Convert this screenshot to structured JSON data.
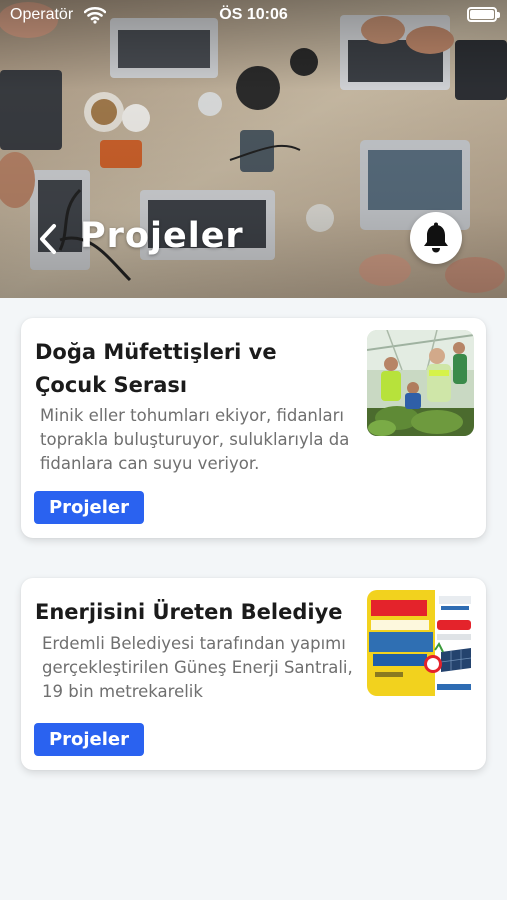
{
  "status_bar": {
    "carrier": "Operatör",
    "time": "ÖS 10:06",
    "wifi_icon": "wifi-icon",
    "battery_icon": "battery-icon",
    "battery_level": 1.0
  },
  "header": {
    "title": "Projeler",
    "back_icon": "chevron-left-icon",
    "notification_icon": "bell-icon",
    "background_image": "office-desk-laptops-photo"
  },
  "projects": [
    {
      "title": "Doğa Müfettişleri ve Çocuk Serası",
      "description": "Minik eller tohumları ekiyor, fidanları toprakla buluşturuyor, suluklarıyla da fidanlara can suyu veriyor.",
      "button_label": "Projeler",
      "thumbnail": "greenhouse-children-photo"
    },
    {
      "title": "Enerjisini Üreten Belediye",
      "description": "Erdemli Belediyesi tarafından yapımı gerçekleştirilen Güneş Enerji Santrali, 19 bin metrekarelik",
      "button_label": "Projeler",
      "thumbnail": "solar-energy-poster"
    }
  ],
  "colors": {
    "accent": "#2a62f0",
    "page_background": "#f3f6f8",
    "card_background": "#ffffff",
    "title_text": "#1b1b1b",
    "description_text": "#6f6f6f"
  }
}
